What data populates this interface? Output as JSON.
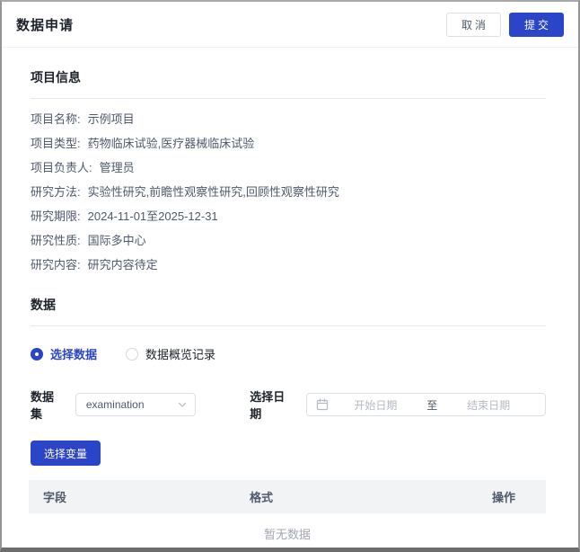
{
  "window": {
    "title": "数据申请",
    "cancel_label": "取消",
    "submit_label": "提交"
  },
  "project": {
    "title": "项目信息",
    "fields": [
      {
        "label": "项目名称:",
        "value": "示例项目"
      },
      {
        "label": "项目类型:",
        "value": "药物临床试验,医疗器械临床试验"
      },
      {
        "label": "项目负责人:",
        "value": "管理员"
      },
      {
        "label": "研究方法:",
        "value": "实验性研究,前瞻性观察性研究,回顾性观察性研究"
      },
      {
        "label": "研究期限:",
        "value": "2024-11-01至2025-12-31"
      },
      {
        "label": "研究性质:",
        "value": "国际多中心"
      },
      {
        "label": "研究内容:",
        "value": "研究内容待定"
      }
    ]
  },
  "data_section": {
    "title": "数据",
    "radios": [
      {
        "label": "选择数据",
        "selected": true
      },
      {
        "label": "数据概览记录",
        "selected": false
      }
    ],
    "dataset": {
      "label": "数据集",
      "selected_value": "examination",
      "dropdown_icon": "chevron-down-icon"
    },
    "date_range": {
      "label": "选择日期",
      "icon": "calendar-icon",
      "start_placeholder": "开始日期",
      "separator": "至",
      "end_placeholder": "结束日期"
    },
    "select_variables_label": "选择变量",
    "table": {
      "headers": [
        "字段",
        "格式",
        "操作"
      ],
      "rows": [],
      "empty_text": "暂无数据"
    }
  },
  "colors": {
    "primary": "#2b45c9",
    "divider": "#e5e6eb",
    "table_header_bg": "#f2f3f5",
    "text_main": "#1d2129",
    "text_secondary": "#4e5969",
    "placeholder": "#b4bac4",
    "window_border": "#949494"
  }
}
